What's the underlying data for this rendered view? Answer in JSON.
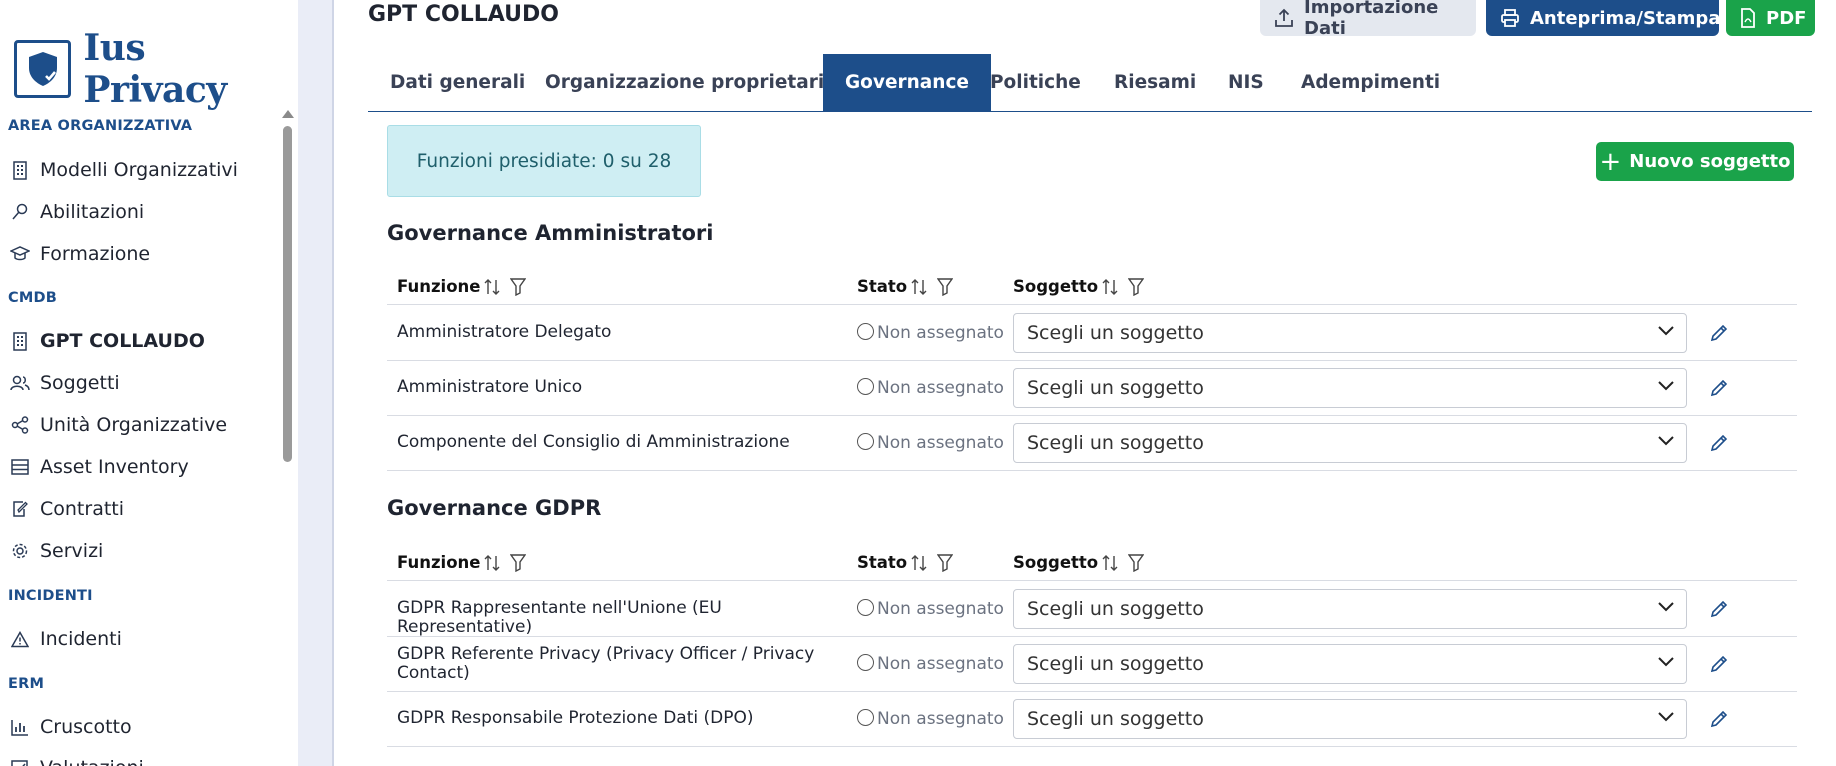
{
  "brand": {
    "name": "Ius Privacy",
    "logo_icon": "shield-check-icon"
  },
  "sidebar": {
    "sections": [
      {
        "label": "AREA ORGANIZZATIVA"
      },
      {
        "label": "CMDB"
      },
      {
        "label": "INCIDENTI"
      },
      {
        "label": "ERM"
      }
    ],
    "items": [
      {
        "label": "Modelli Organizzativi",
        "icon": "building-icon"
      },
      {
        "label": "Abilitazioni",
        "icon": "key-icon"
      },
      {
        "label": "Formazione",
        "icon": "graduation-cap-icon"
      },
      {
        "label": "GPT COLLAUDO",
        "icon": "building-icon"
      },
      {
        "label": "Soggetti",
        "icon": "users-icon"
      },
      {
        "label": "Unità Organizzative",
        "icon": "share-nodes-icon"
      },
      {
        "label": "Asset Inventory",
        "icon": "server-icon"
      },
      {
        "label": "Contratti",
        "icon": "contract-icon"
      },
      {
        "label": "Servizi",
        "icon": "gear-icon"
      },
      {
        "label": "Incidenti",
        "icon": "warning-icon"
      },
      {
        "label": "Cruscotto",
        "icon": "bar-chart-icon"
      },
      {
        "label": "Valutazioni",
        "icon": "checklist-icon"
      }
    ]
  },
  "header": {
    "title": "GPT COLLAUDO",
    "import_label": "Importazione Dati",
    "preview_label": "Anteprima/Stampa",
    "pdf_label": "PDF"
  },
  "tabs": [
    {
      "label": "Dati generali"
    },
    {
      "label": "Organizzazione proprietaria"
    },
    {
      "label": "Governance"
    },
    {
      "label": "Politiche"
    },
    {
      "label": "Riesami"
    },
    {
      "label": "NIS"
    },
    {
      "label": "Adempimenti"
    }
  ],
  "summary": {
    "text": "Funzioni presidiate: 0 su 28"
  },
  "new_subject_label": "Nuovo soggetto",
  "columns": {
    "funzione": "Funzione",
    "stato": "Stato",
    "soggetto": "Soggetto"
  },
  "groups": [
    {
      "title": "Governance Amministratori",
      "rows": [
        {
          "funzione": "Amministratore Delegato",
          "stato": "Non assegnato",
          "soggetto": "Scegli un soggetto"
        },
        {
          "funzione": "Amministratore Unico",
          "stato": "Non assegnato",
          "soggetto": "Scegli un soggetto"
        },
        {
          "funzione": "Componente del Consiglio di Amministrazione",
          "stato": "Non assegnato",
          "soggetto": "Scegli un soggetto"
        }
      ]
    },
    {
      "title": "Governance GDPR",
      "rows": [
        {
          "funzione": "GDPR Rappresentante nell'Unione (EU Representative)",
          "stato": "Non assegnato",
          "soggetto": "Scegli un soggetto"
        },
        {
          "funzione": "GDPR Referente Privacy (Privacy Officer / Privacy Contact)",
          "stato": "Non assegnato",
          "soggetto": "Scegli un soggetto"
        },
        {
          "funzione": "GDPR Responsabile Protezione Dati (DPO)",
          "stato": "Non assegnato",
          "soggetto": "Scegli un soggetto"
        }
      ]
    }
  ]
}
